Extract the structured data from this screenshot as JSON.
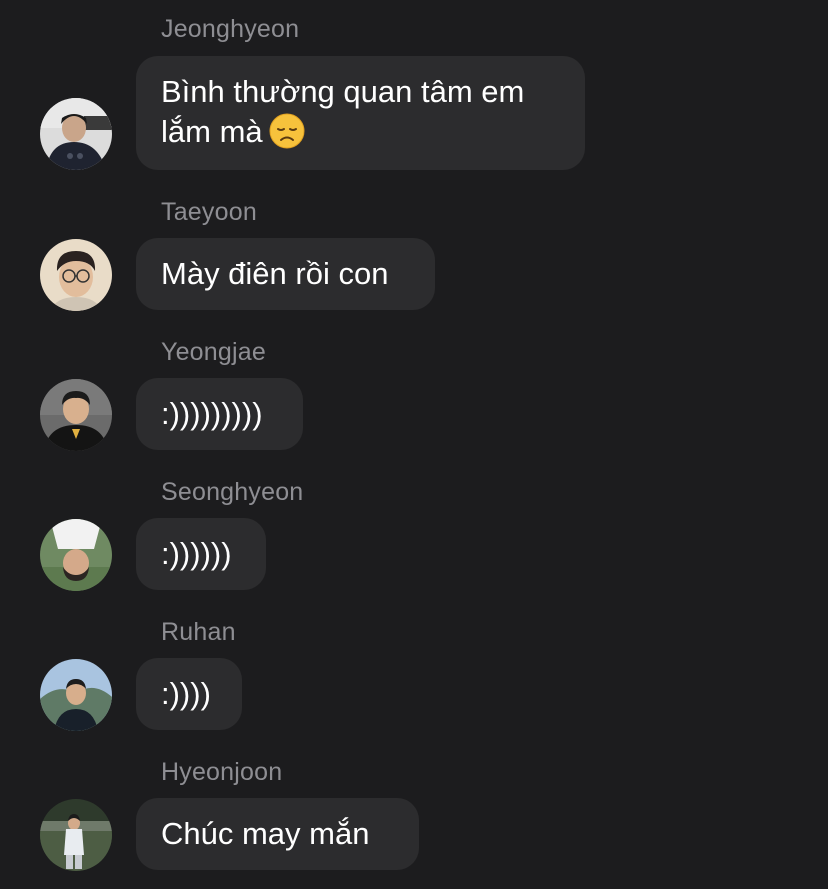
{
  "messages": [
    {
      "sender": "Jeonghyeon",
      "lines": [
        "Bình thường quan tâm em",
        "lắm mà"
      ],
      "emoji": "disappointed-face-emoji",
      "avatar": "avatar-jeonghyeon"
    },
    {
      "sender": "Taeyoon",
      "lines": [
        "Mày điên rồi con"
      ],
      "avatar": "avatar-taeyoon"
    },
    {
      "sender": "Yeongjae",
      "lines": [
        ":)))))))))"
      ],
      "avatar": "avatar-yeongjae"
    },
    {
      "sender": "Seonghyeon",
      "lines": [
        ":))))))"
      ],
      "avatar": "avatar-seonghyeon"
    },
    {
      "sender": "Ruhan",
      "lines": [
        ":))))"
      ],
      "avatar": "avatar-ruhan"
    },
    {
      "sender": "Hyeonjoon",
      "lines": [
        "Chúc may mắn"
      ],
      "avatar": "avatar-hyeonjoon"
    }
  ],
  "colors": {
    "background": "#1c1c1e",
    "bubble": "#2c2c2e",
    "sender_text": "#8e8e93",
    "message_text": "#ffffff"
  }
}
